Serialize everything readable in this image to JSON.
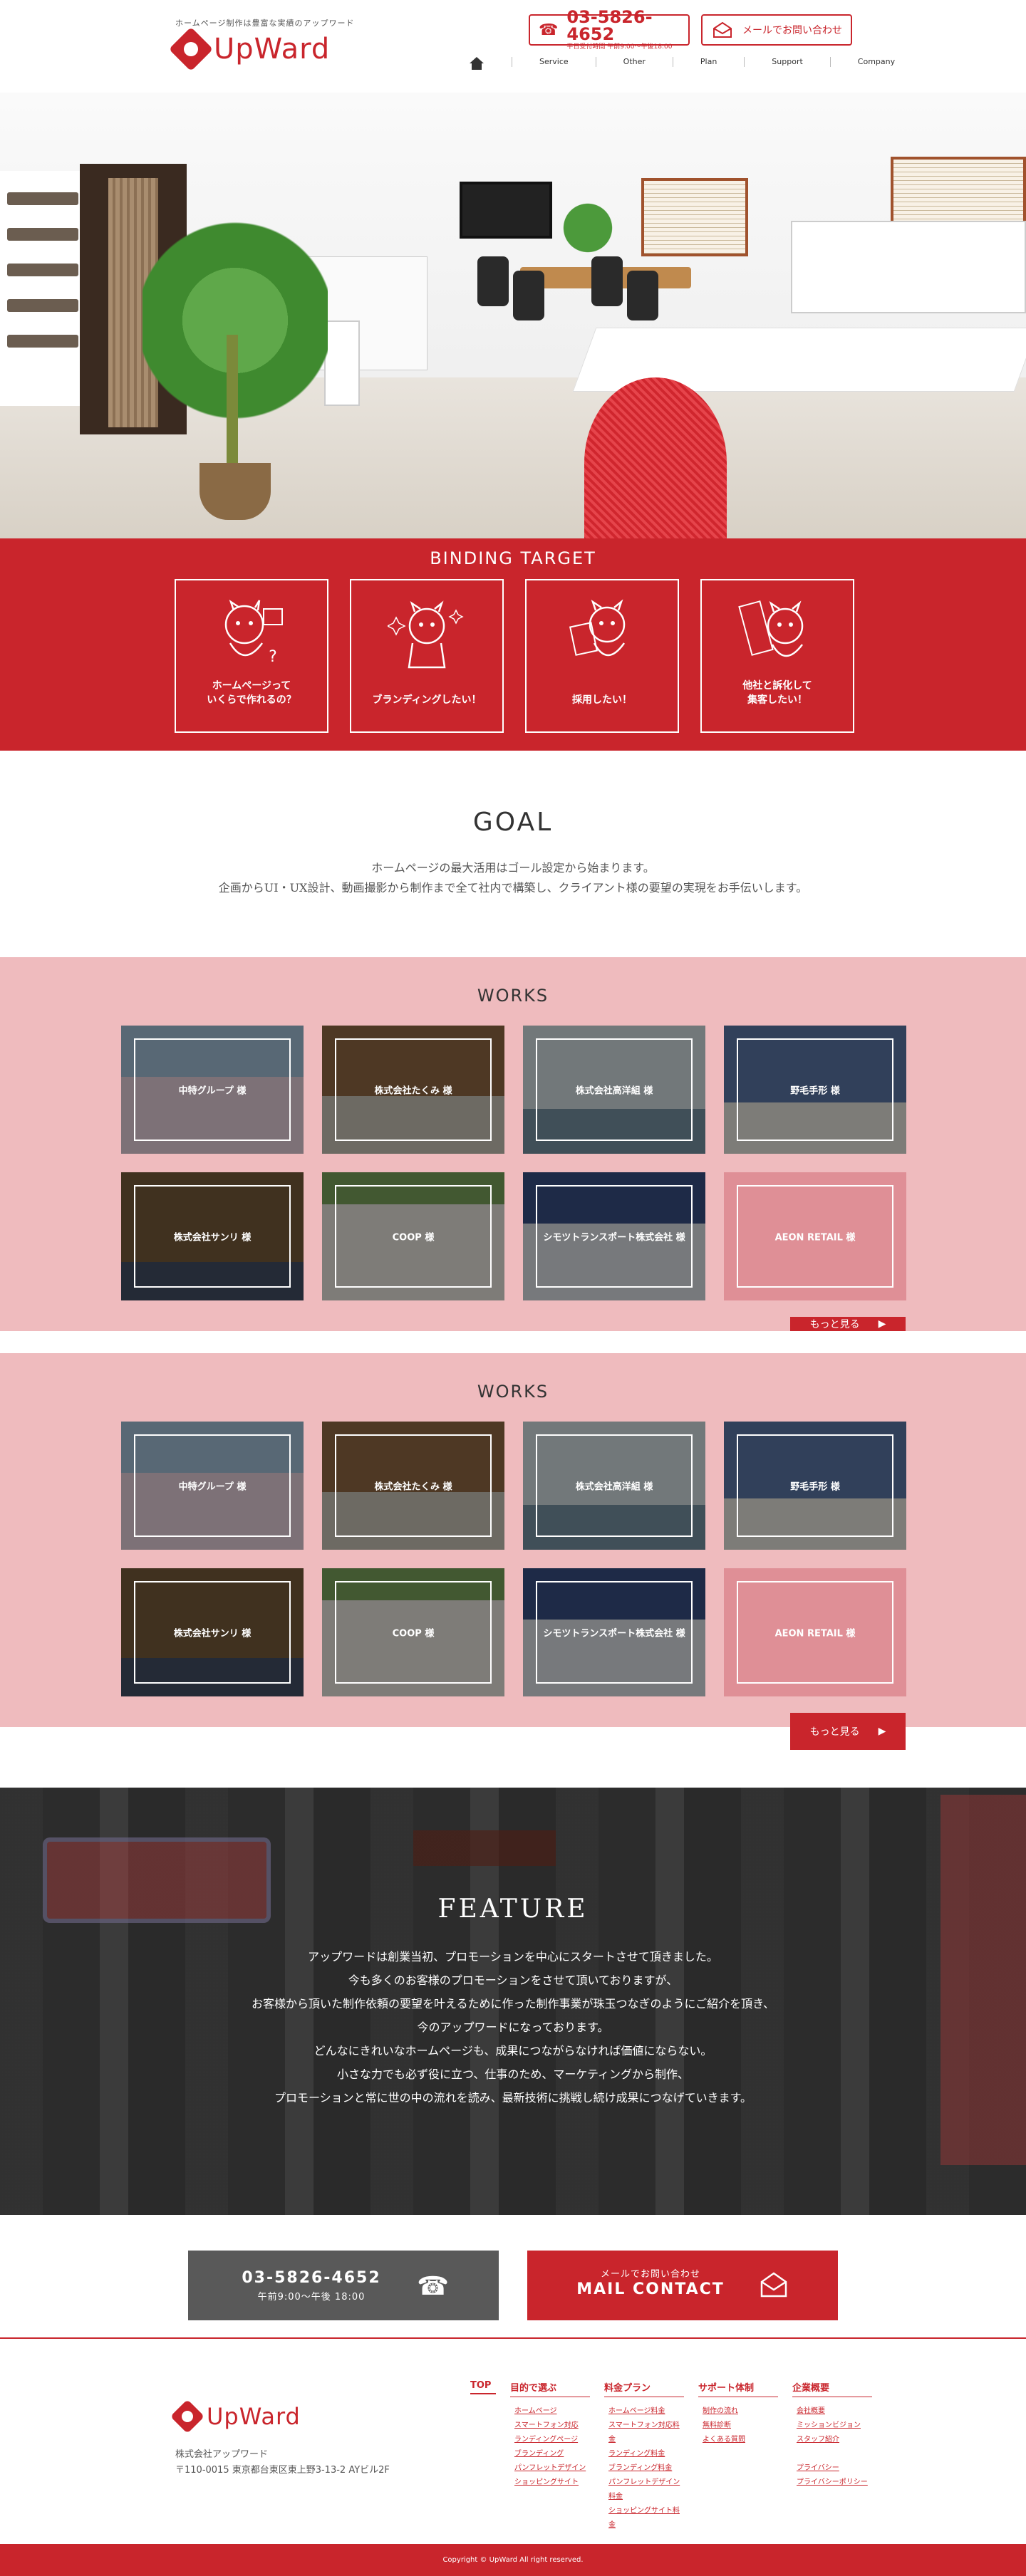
{
  "header": {
    "tagline": "ホームページ制作は豊富な実績のアップワード",
    "logo_text": "UpWard",
    "tel": {
      "number": "03-5826-4652",
      "hours": "平日受付時間 午前9:00〜午後18:00"
    },
    "mail_label": "メールでお問い合わせ",
    "nav": [
      "Service",
      "Other",
      "Plan",
      "Support",
      "Company"
    ]
  },
  "binding": {
    "title": "BINDING TARGET",
    "cards": [
      {
        "label": "ホームページって\nいくらで作れるの？",
        "icon": "cat-question-icon"
      },
      {
        "label": "ブランディングしたい！",
        "icon": "cat-sparkle-icon"
      },
      {
        "label": "採用したい！",
        "icon": "cat-recruit-icon"
      },
      {
        "label": "他社と訴化して\n集客したい！",
        "icon": "cat-flag-icon"
      }
    ]
  },
  "goal": {
    "title": "GOAL",
    "text1": "ホームページの最大活用はゴール設定から始まります。",
    "text2": "企画からUI・UX設計、動画撮影から制作まで全て社内で構築し、クライアント様の要望の実現をお手伝いします。"
  },
  "works1": {
    "title": "WORKS",
    "items": [
      "中特グループ 様",
      "株式会社たくみ 様",
      "株式会社高洋組 様",
      "野毛手形 様",
      "株式会社サンリ 様",
      "COOP 様",
      "シモツトランスポート株式会社 様",
      "AEON RETAIL 様"
    ],
    "more": "もっと見る"
  },
  "works2": {
    "title": "WORKS",
    "items": [
      "中特グループ 様",
      "株式会社たくみ 様",
      "株式会社高洋組 様",
      "野毛手形 様",
      "株式会社サンリ 様",
      "COOP 様",
      "シモツトランスポート株式会社 様",
      "AEON RETAIL 様"
    ],
    "more": "もっと見る"
  },
  "feature": {
    "title": "FEATURE",
    "lines": [
      "アップワードは創業当初、プロモーションを中心にスタートさせて頂きました。",
      "今も多くのお客様のプロモーションをさせて頂いておりますが、",
      "お客様から頂いた制作依頼の要望を叶えるために作った制作事業が珠玉つなぎのようにご紹介を頂き、",
      "今のアップワードになっております。",
      "どんなにきれいなホームページも、成果につながらなければ価値にならない。",
      "小さな力でも必ず役に立つ、仕事のため、マーケティングから制作、",
      "プロモーションと常に世の中の流れを読み、最新技術に挑戦し続け成果につなげていきます。"
    ]
  },
  "contact": {
    "tel_number": "03-5826-4652",
    "tel_hours": "午前9:00〜午後 18:00",
    "mail_sub": "メールでお問い合わせ",
    "mail_main": "MAIL CONTACT"
  },
  "footer": {
    "logo_text": "UpWard",
    "company": "株式会社アップワード",
    "address": "〒110-0015 東京都台東区東上野3-13-2 AYビル2F",
    "top_label": "TOP",
    "columns": [
      {
        "head": "目的で選ぶ",
        "links": [
          "ホームページ",
          "スマートフォン対応",
          "ランディングページ",
          "ブランディング",
          "パンフレットデザイン",
          "ショッピングサイト"
        ]
      },
      {
        "head": "料金プラン",
        "links": [
          "ホームページ料金",
          "スマートフォン対応料金",
          "ランディング料金",
          "ブランディング料金",
          "パンフレットデザイン料金",
          "ショッピングサイト料金"
        ]
      },
      {
        "head": "サポート体制",
        "links": [
          "制作の流れ",
          "無料診断",
          "よくある質問"
        ]
      },
      {
        "head": "企業概要",
        "links": [
          "会社概要",
          "ミッションビジョン",
          "スタッフ紹介",
          "",
          "プライバシー",
          "プライバシーポリシー"
        ]
      }
    ],
    "copyright": "Copyright © UpWard All right reserved."
  },
  "colors": {
    "accent": "#c9252c",
    "pink": "#efbbbe",
    "dark": "#595959"
  }
}
